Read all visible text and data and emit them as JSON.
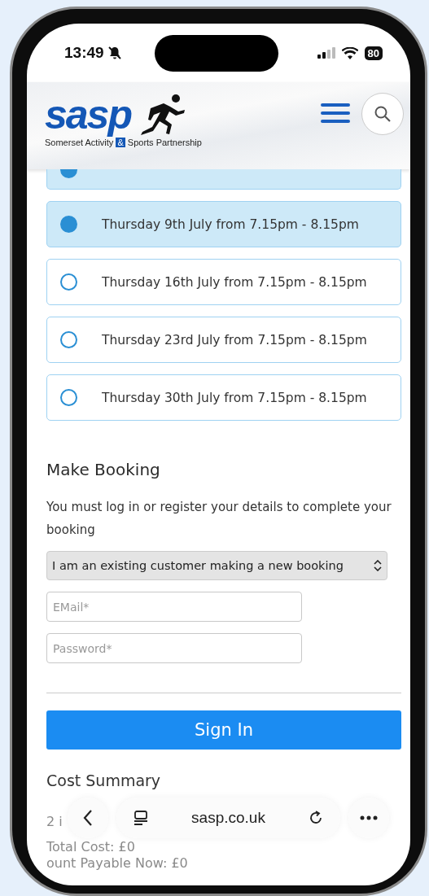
{
  "status_bar": {
    "time": "13:49",
    "battery": "80"
  },
  "header": {
    "logo_word": "sasp",
    "tagline_start": "Somerset Activity",
    "tagline_amp": "&",
    "tagline_end": "Sports Partnership"
  },
  "sessions": [
    {
      "selected": true
    },
    {
      "label": "Thursday 9th July from 7.15pm - 8.15pm",
      "selected": true
    },
    {
      "label": "Thursday 16th July from 7.15pm - 8.15pm",
      "selected": false
    },
    {
      "label": "Thursday 23rd July from 7.15pm - 8.15pm",
      "selected": false
    },
    {
      "label": "Thursday 30th July from 7.15pm - 8.15pm",
      "selected": false
    }
  ],
  "booking": {
    "heading": "Make Booking",
    "note": "You must log in or register your details to complete your booking",
    "customer_type": "I am an existing customer making a new booking",
    "email_placeholder": "EMail*",
    "password_placeholder": "Password*",
    "sign_in": "Sign In"
  },
  "cost_summary": {
    "heading": "Cost Summary",
    "lines": [
      "2 i",
      "Total Cost: £0",
      "ount Payable Now: £0"
    ]
  },
  "browser_bar": {
    "url": "sasp.co.uk"
  }
}
